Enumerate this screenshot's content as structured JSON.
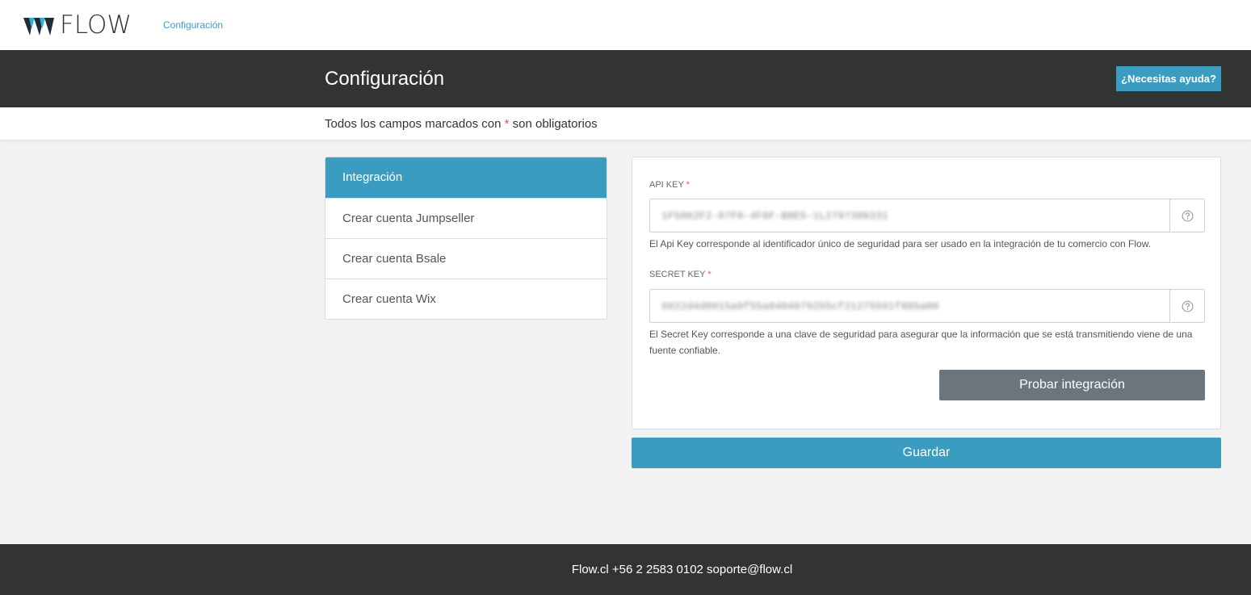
{
  "topnav": {
    "logo_text": "FLOW",
    "link": "Configuración"
  },
  "header": {
    "title": "Configuración",
    "help_button": "¿Necesitas ayuda?"
  },
  "notice": {
    "prefix": "Todos los campos marcados con ",
    "star": "*",
    "suffix": " son obligatorios"
  },
  "menu": {
    "items": [
      {
        "label": "Integración",
        "active": true
      },
      {
        "label": "Crear cuenta Jumpseller",
        "active": false
      },
      {
        "label": "Crear cuenta Bsale",
        "active": false
      },
      {
        "label": "Crear cuenta Wix",
        "active": false
      }
    ]
  },
  "form": {
    "api_key": {
      "label": "API KEY",
      "required_mark": "*",
      "value": "1F5062F2-87F0-4F6F-B8E5-1L2797308331",
      "help": "El Api Key corresponde al identificador único de seguridad para ser usado en la integración de tu comercio con Flow.",
      "addon_icon": "question-circle-icon"
    },
    "secret_key": {
      "label": "SECRET KEY",
      "required_mark": "*",
      "value": "6022d4d8015a9f55a8404879255cf21275591f885a00",
      "help": "El Secret Key corresponde a una clave de seguridad para asegurar que la información que se está transmitiendo viene de una fuente confiable.",
      "addon_icon": "question-circle-icon"
    },
    "test_button": "Probar integración",
    "save_button": "Guardar"
  },
  "footer": {
    "text": "Flow.cl +56 2 2583 0102 soporte@flow.cl"
  },
  "colors": {
    "accent": "#3a9cc0",
    "dark": "#333333",
    "secondary_button": "#6c757d",
    "required": "#e4555a"
  }
}
